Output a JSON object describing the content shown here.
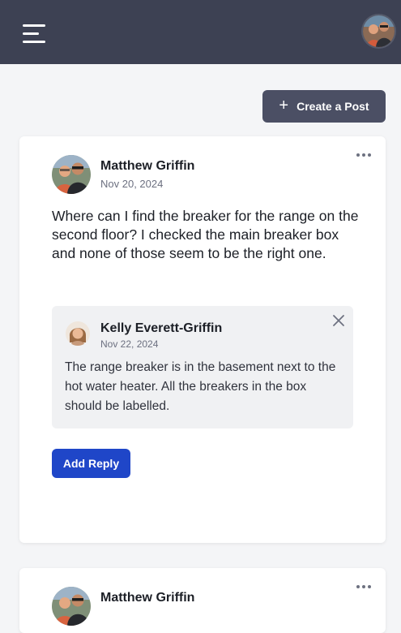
{
  "header": {
    "menu_icon": "hamburger-menu-icon",
    "user_avatar": "user-avatar"
  },
  "actions": {
    "create_post_label": "Create a Post",
    "create_post_icon": "plus-icon"
  },
  "posts": [
    {
      "author": "Matthew Griffin",
      "date": "Nov 20, 2024",
      "body": "Where can I find the breaker for the range on the second floor? I checked the main breaker box and none of those seem to be the right one.",
      "replies": [
        {
          "author": "Kelly Everett-Griffin",
          "date": "Nov 22, 2024",
          "body": "The range breaker is in the basement next to the hot water heater. All the breakers in the box should be labelled."
        }
      ],
      "add_reply_label": "Add Reply"
    },
    {
      "author": "Matthew Griffin"
    }
  ],
  "colors": {
    "topbar": "#3d4153",
    "create_post_button": "#4b4f64",
    "add_reply_button": "#1f46c8",
    "page_background": "#f4f5f7"
  }
}
